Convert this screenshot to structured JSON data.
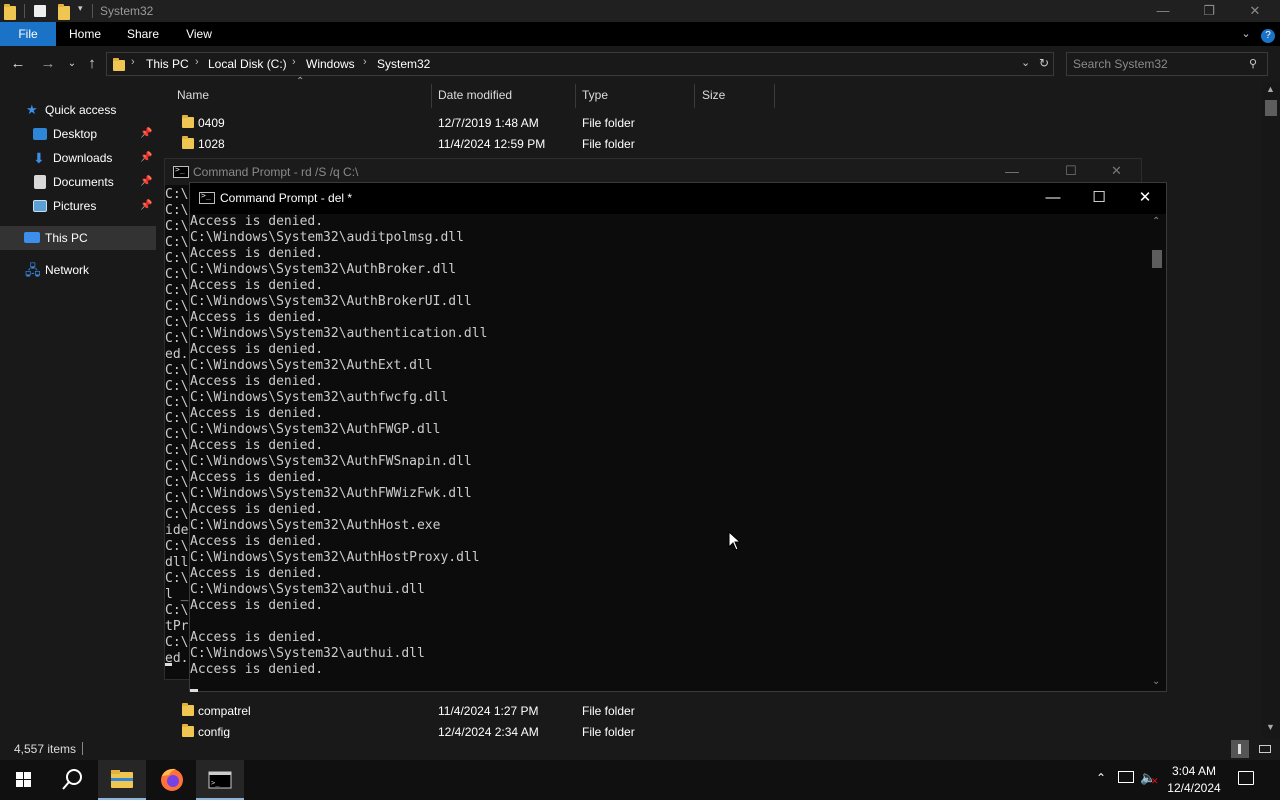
{
  "explorer": {
    "window_title": "System32",
    "ribbon_tabs": [
      "File",
      "Home",
      "Share",
      "View"
    ],
    "breadcrumb": [
      "This PC",
      "Local Disk (C:)",
      "Windows",
      "System32"
    ],
    "search_placeholder": "Search System32",
    "nav": {
      "quick_access": "Quick access",
      "desktop": "Desktop",
      "downloads": "Downloads",
      "documents": "Documents",
      "pictures": "Pictures",
      "this_pc": "This PC",
      "network": "Network"
    },
    "columns": [
      "Name",
      "Date modified",
      "Type",
      "Size"
    ],
    "rows_top": [
      {
        "name": "0409",
        "date": "12/7/2019 1:48 AM",
        "type": "File folder"
      },
      {
        "name": "1028",
        "date": "11/4/2024 12:59 PM",
        "type": "File folder"
      }
    ],
    "rows_bottom": [
      {
        "name": "compatrel",
        "date": "11/4/2024 1:27 PM",
        "type": "File folder"
      },
      {
        "name": "config",
        "date": "12/4/2024 2:34 AM",
        "type": "File folder"
      }
    ],
    "status_items": "4,557 items"
  },
  "cmd_back": {
    "title": "Command Prompt - rd  /S /q C:\\",
    "text": "C:\\\nC:\\\nC:\\\nC:\\\nC:\\\nC:\\\nC:\\\nC:\\\nC:\\\nC:\\\ned.\nC:\\\nC:\\\nC:\\\nC:\\\nC:\\\nC:\\\nC:\\\nC:\\\nC:\\\nC:\\\nide\nC:\\\ndll\nC:\\\nl _\nC:\\\ntPr\nC:\\\ned."
  },
  "cmd_front": {
    "title": "Command Prompt - del  *",
    "text": "Access is denied.\nC:\\Windows\\System32\\auditpolmsg.dll\nAccess is denied.\nC:\\Windows\\System32\\AuthBroker.dll\nAccess is denied.\nC:\\Windows\\System32\\AuthBrokerUI.dll\nAccess is denied.\nC:\\Windows\\System32\\authentication.dll\nAccess is denied.\nC:\\Windows\\System32\\AuthExt.dll\nAccess is denied.\nC:\\Windows\\System32\\authfwcfg.dll\nAccess is denied.\nC:\\Windows\\System32\\AuthFWGP.dll\nAccess is denied.\nC:\\Windows\\System32\\AuthFWSnapin.dll\nAccess is denied.\nC:\\Windows\\System32\\AuthFWWizFwk.dll\nAccess is denied.\nC:\\Windows\\System32\\AuthHost.exe\nAccess is denied.\nC:\\Windows\\System32\\AuthHostProxy.dll\nAccess is denied.\nC:\\Windows\\System32\\authui.dll\nAccess is denied.\n\nAccess is denied.\nC:\\Windows\\System32\\authui.dll\nAccess is denied."
  },
  "taskbar": {
    "time": "3:04 AM",
    "date": "12/4/2024",
    "apps": [
      "start-icon",
      "search-icon",
      "file-explorer-icon",
      "firefox-icon",
      "command-prompt-icon"
    ]
  }
}
